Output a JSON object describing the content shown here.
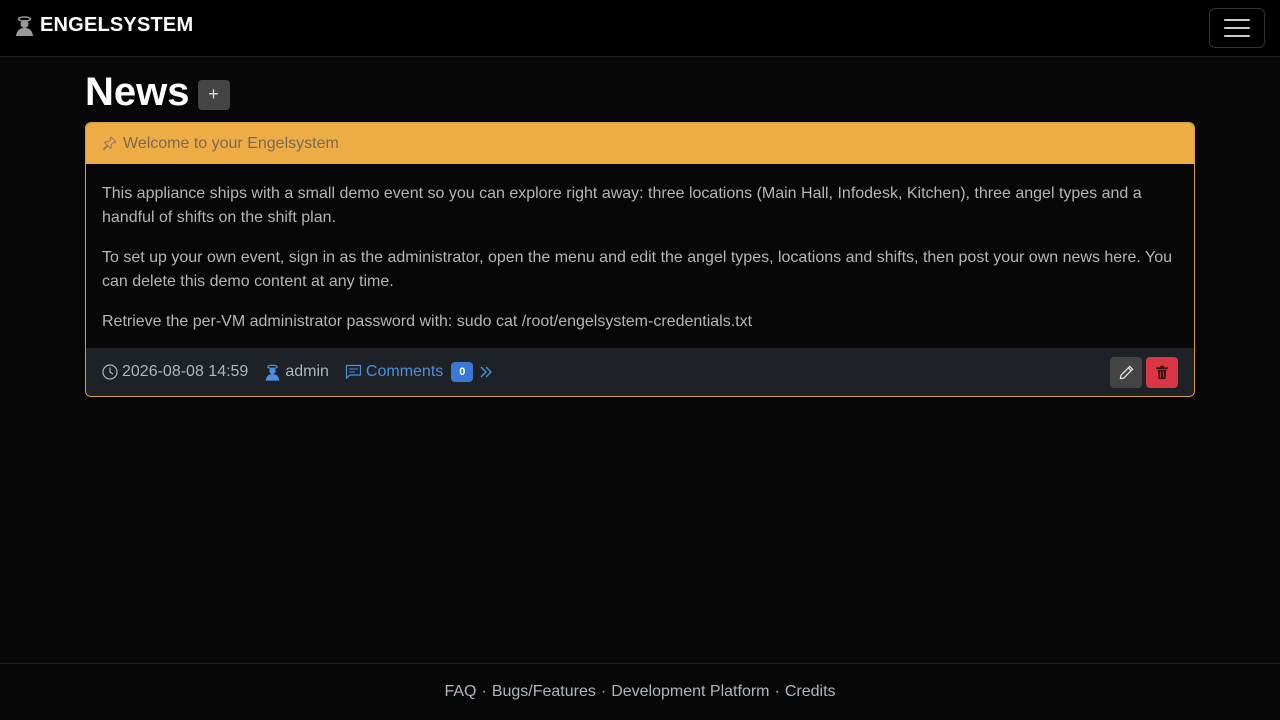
{
  "navbar": {
    "brand": "ENGELSYSTEM",
    "brand_icon": "angel-icon",
    "menu_icon": "hamburger-icon"
  },
  "page": {
    "title": "News",
    "add_label": "+"
  },
  "news": {
    "title": "Welcome to your Engelsystem",
    "paragraphs": [
      "This appliance ships with a small demo event so you can explore right away: three locations (Main Hall, Infodesk, Kitchen), three angel types and a handful of shifts on the shift plan.",
      "To set up your own event, sign in as the administrator, open the menu and edit the angel types, locations and shifts, then post your own news here. You can delete this demo content at any time.",
      "Retrieve the per-VM administrator password with: sudo cat /root/engelsystem-credentials.txt"
    ],
    "timestamp": "2026-08-08 14:59",
    "author": "admin",
    "comments_label": "Comments",
    "comments_count": "0"
  },
  "footer": {
    "links": [
      "FAQ",
      "Bugs/Features",
      "Development Platform",
      "Credits"
    ],
    "separator": "·"
  },
  "colors": {
    "header_bg": "#eead44",
    "link": "#4b8fe2",
    "danger": "#dc3545",
    "badge": "#3a78d6"
  }
}
